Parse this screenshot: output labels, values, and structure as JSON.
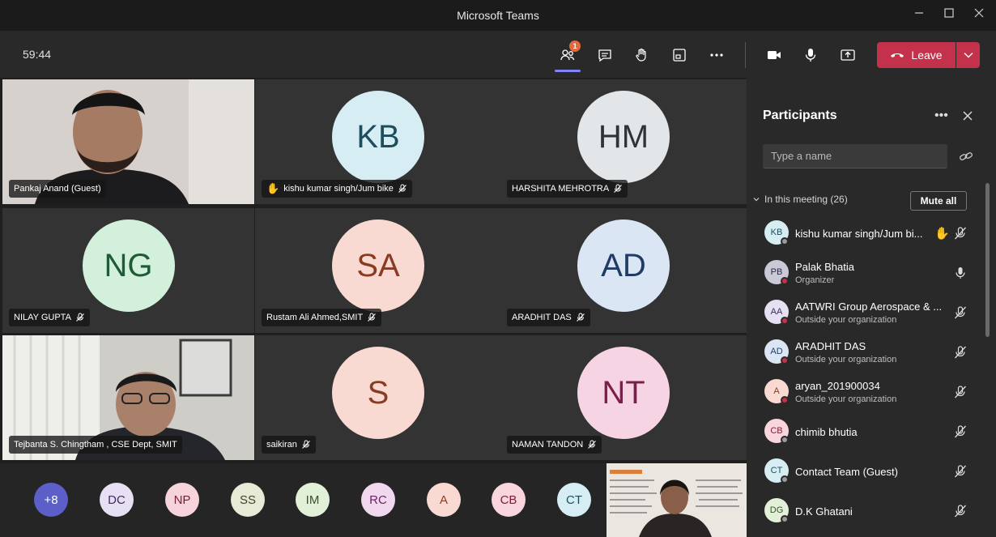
{
  "window": {
    "title": "Microsoft Teams"
  },
  "toolbar": {
    "timer": "59:44",
    "participants_badge": "1",
    "leave_label": "Leave"
  },
  "tiles": [
    {
      "name": "Pankaj Anand (Guest)",
      "type": "video",
      "muted": false,
      "hand": false
    },
    {
      "name": "kishu kumar singh/Jum bike",
      "initials": "KB",
      "bg": "#d6eef3",
      "fg": "#1e4e5c",
      "muted": true,
      "hand": true
    },
    {
      "name": "HARSHITA MEHROTRA",
      "initials": "HM",
      "bg": "#e2e6e8",
      "fg": "#2d3438",
      "muted": true,
      "hand": false
    },
    {
      "name": "NILAY GUPTA",
      "initials": "NG",
      "bg": "#d3f0dc",
      "fg": "#1f5b35",
      "muted": true,
      "hand": false
    },
    {
      "name": "Rustam Ali Ahmed,SMIT",
      "initials": "SA",
      "bg": "#f9dad2",
      "fg": "#8a3b24",
      "muted": true,
      "hand": false
    },
    {
      "name": "ARADHIT DAS",
      "initials": "AD",
      "bg": "#dbe6f5",
      "fg": "#203c66",
      "muted": true,
      "hand": false
    },
    {
      "name": "Tejbanta S. Chingtham , CSE Dept, SMIT",
      "type": "video",
      "muted": false,
      "hand": false
    },
    {
      "name": "saikiran",
      "initials": "S",
      "bg": "#f9dad2",
      "fg": "#8a3b24",
      "muted": true,
      "hand": false
    },
    {
      "name": "NAMAN TANDON",
      "initials": "NT",
      "bg": "#f7d4e4",
      "fg": "#7a1f4a",
      "muted": true,
      "hand": false
    }
  ],
  "overflow_chips": [
    {
      "label": "+8",
      "bg": "#5b5fc7",
      "fg": "#ffffff"
    },
    {
      "label": "DC",
      "bg": "#e6e0f2",
      "fg": "#3b2d66"
    },
    {
      "label": "NP",
      "bg": "#f7d4dc",
      "fg": "#7a1f33"
    },
    {
      "label": "SS",
      "bg": "#e8ead8",
      "fg": "#3f4424"
    },
    {
      "label": "IM",
      "bg": "#e3f0d8",
      "fg": "#35522a"
    },
    {
      "label": "RC",
      "bg": "#f1d8ef",
      "fg": "#6a2464"
    },
    {
      "label": "A",
      "bg": "#f9dad2",
      "fg": "#8a3b24"
    },
    {
      "label": "CB",
      "bg": "#f9d5dd",
      "fg": "#7a1f35"
    },
    {
      "label": "CT",
      "bg": "#d6eef3",
      "fg": "#1e4e5c"
    }
  ],
  "panel": {
    "title": "Participants",
    "search_placeholder": "Type a name",
    "section_label": "In this meeting (26)",
    "mute_all_label": "Mute all",
    "participants": [
      {
        "initials": "KB",
        "name": "kishu kumar singh/Jum bi...",
        "sub": "",
        "bg": "#d6eef3",
        "fg": "#1e4e5c",
        "status": "#9a9a9a",
        "hand": true,
        "mic": "muted"
      },
      {
        "initials": "PB",
        "name": "Palak Bhatia",
        "sub": "Organizer",
        "bg": "#c9c9d8",
        "fg": "#2a2a44",
        "status": "#c4314b",
        "hand": false,
        "mic": "on"
      },
      {
        "initials": "AA",
        "name": "AATWRI Group Aerospace & ...",
        "sub": "Outside your organization",
        "bg": "#e6e0f2",
        "fg": "#3b2d66",
        "status": "#c4314b",
        "hand": false,
        "mic": "muted"
      },
      {
        "initials": "AD",
        "name": "ARADHIT DAS",
        "sub": "Outside your organization",
        "bg": "#dbe6f5",
        "fg": "#203c66",
        "status": "#c4314b",
        "hand": false,
        "mic": "muted"
      },
      {
        "initials": "A",
        "name": "aryan_201900034",
        "sub": "Outside your organization",
        "bg": "#f9dad2",
        "fg": "#8a3b24",
        "status": "#c4314b",
        "hand": false,
        "mic": "muted"
      },
      {
        "initials": "CB",
        "name": "chimib bhutia",
        "sub": "",
        "bg": "#f9d5dd",
        "fg": "#7a1f35",
        "status": "#9a9a9a",
        "hand": false,
        "mic": "muted"
      },
      {
        "initials": "CT",
        "name": "Contact Team (Guest)",
        "sub": "",
        "bg": "#d6eef3",
        "fg": "#1e4e5c",
        "status": "#9a9a9a",
        "hand": false,
        "mic": "muted"
      },
      {
        "initials": "DG",
        "name": "D.K Ghatani",
        "sub": "",
        "bg": "#e3f0d8",
        "fg": "#35522a",
        "status": "#9a9a9a",
        "hand": false,
        "mic": "muted"
      }
    ]
  }
}
